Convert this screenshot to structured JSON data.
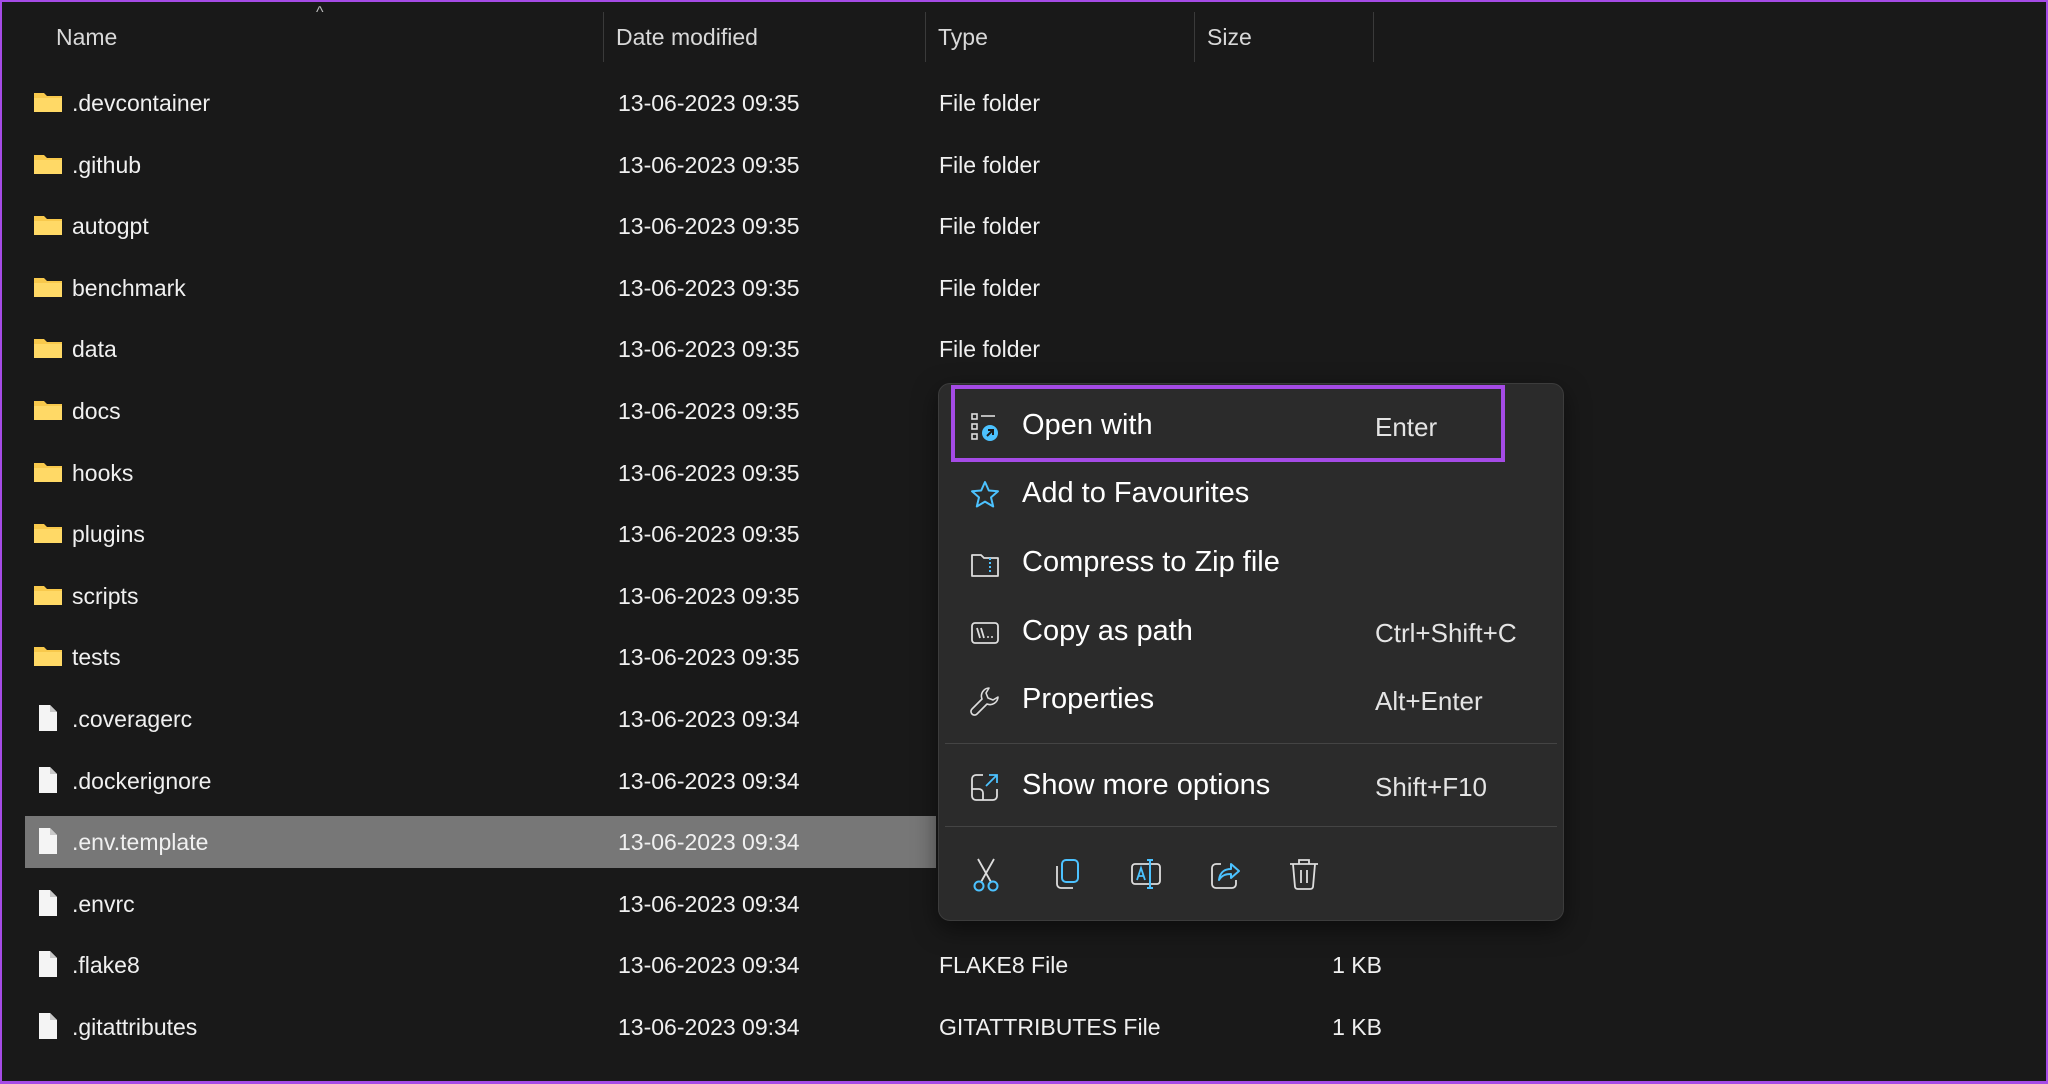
{
  "header": {
    "columns": [
      "Name",
      "Date modified",
      "Type",
      "Size"
    ],
    "sort_indicator": "^"
  },
  "files": [
    {
      "name": ".devcontainer",
      "date": "13-06-2023 09:35",
      "type": "File folder",
      "size": "",
      "kind": "folder"
    },
    {
      "name": ".github",
      "date": "13-06-2023 09:35",
      "type": "File folder",
      "size": "",
      "kind": "folder"
    },
    {
      "name": "autogpt",
      "date": "13-06-2023 09:35",
      "type": "File folder",
      "size": "",
      "kind": "folder"
    },
    {
      "name": "benchmark",
      "date": "13-06-2023 09:35",
      "type": "File folder",
      "size": "",
      "kind": "folder"
    },
    {
      "name": "data",
      "date": "13-06-2023 09:35",
      "type": "File folder",
      "size": "",
      "kind": "folder"
    },
    {
      "name": "docs",
      "date": "13-06-2023 09:35",
      "type": "",
      "size": "",
      "kind": "folder"
    },
    {
      "name": "hooks",
      "date": "13-06-2023 09:35",
      "type": "",
      "size": "",
      "kind": "folder"
    },
    {
      "name": "plugins",
      "date": "13-06-2023 09:35",
      "type": "",
      "size": "",
      "kind": "folder"
    },
    {
      "name": "scripts",
      "date": "13-06-2023 09:35",
      "type": "",
      "size": "",
      "kind": "folder"
    },
    {
      "name": "tests",
      "date": "13-06-2023 09:35",
      "type": "",
      "size": "",
      "kind": "folder"
    },
    {
      "name": ".coveragerc",
      "date": "13-06-2023 09:34",
      "type": "",
      "size": "",
      "kind": "file"
    },
    {
      "name": ".dockerignore",
      "date": "13-06-2023 09:34",
      "type": "",
      "size": "",
      "kind": "file"
    },
    {
      "name": ".env.template",
      "date": "13-06-2023 09:34",
      "type": "",
      "size": "",
      "kind": "file",
      "selected": true
    },
    {
      "name": ".envrc",
      "date": "13-06-2023 09:34",
      "type": "",
      "size": "",
      "kind": "file"
    },
    {
      "name": ".flake8",
      "date": "13-06-2023 09:34",
      "type": "FLAKE8 File",
      "size": "1 KB",
      "kind": "file"
    },
    {
      "name": ".gitattributes",
      "date": "13-06-2023 09:34",
      "type": "GITATTRIBUTES File",
      "size": "1 KB",
      "kind": "file"
    }
  ],
  "context_menu": {
    "items": [
      {
        "label": "Open with",
        "shortcut": "Enter",
        "icon": "open-with-icon",
        "highlighted": true
      },
      {
        "label": "Add to Favourites",
        "shortcut": "",
        "icon": "star-icon"
      },
      {
        "label": "Compress to Zip file",
        "shortcut": "",
        "icon": "zip-folder-icon"
      },
      {
        "label": "Copy as path",
        "shortcut": "Ctrl+Shift+C",
        "icon": "copy-path-icon"
      },
      {
        "label": "Properties",
        "shortcut": "Alt+Enter",
        "icon": "wrench-icon"
      },
      {
        "label": "Show more options",
        "shortcut": "Shift+F10",
        "icon": "show-more-icon"
      }
    ],
    "actions": [
      "cut-icon",
      "copy-icon",
      "rename-icon",
      "share-icon",
      "delete-icon"
    ]
  },
  "colors": {
    "accent": "#4cc2ff",
    "highlight_border": "#a54be6",
    "selected_row": "#777777",
    "background": "#191919",
    "menu": "#2b2b2b"
  }
}
